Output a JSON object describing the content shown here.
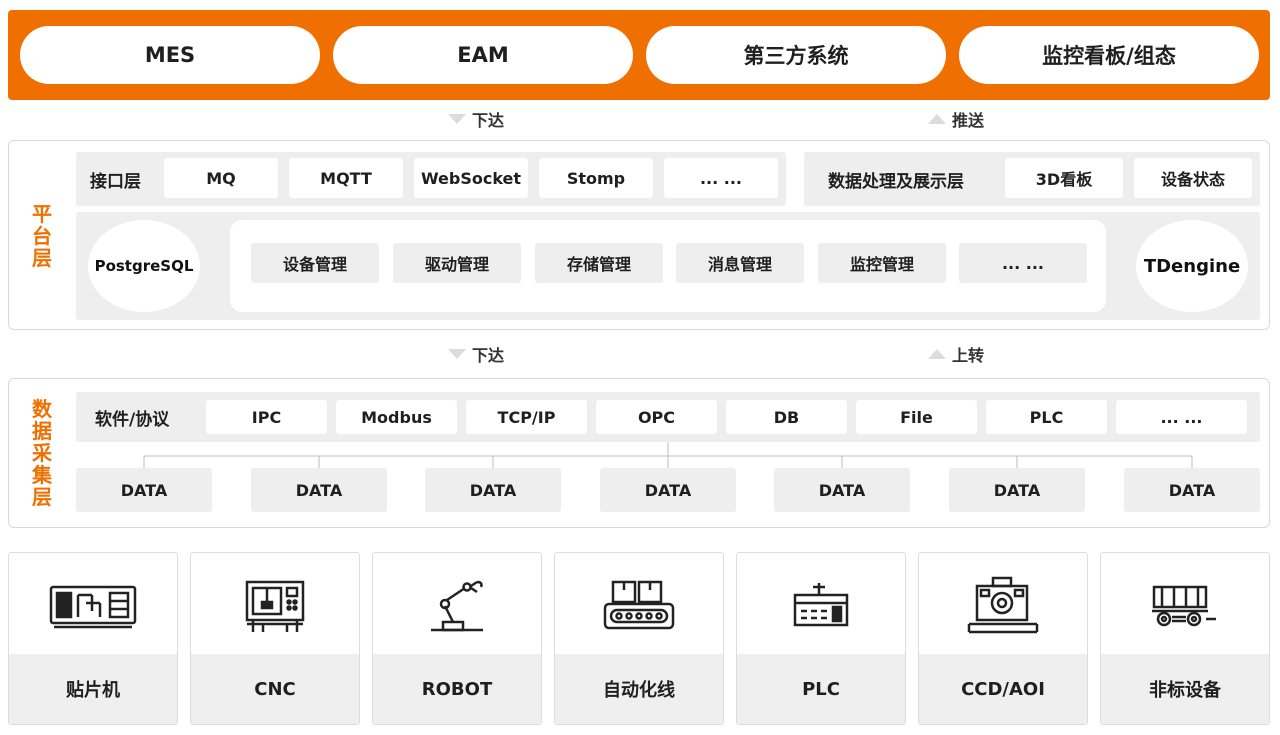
{
  "top_systems": [
    "MES",
    "EAM",
    "第三方系统",
    "监控看板/组态"
  ],
  "flow_top": {
    "down": "下达",
    "up": "推送"
  },
  "platform": {
    "side_label": "平台层",
    "interface_label": "接口层",
    "interface_items": [
      "MQ",
      "MQTT",
      "WebSocket",
      "Stomp",
      "... ..."
    ],
    "display_label": "数据处理及展示层",
    "display_items": [
      "3D看板",
      "设备状态"
    ],
    "left_db": "PostgreSQL",
    "right_db": "TDengine",
    "modules": [
      "设备管理",
      "驱动管理",
      "存储管理",
      "消息管理",
      "监控管理",
      "... ..."
    ]
  },
  "flow_mid": {
    "down": "下达",
    "up": "上转"
  },
  "acquisition": {
    "side_label": "数据采集层",
    "protocol_label": "软件/协议",
    "protocols": [
      "IPC",
      "Modbus",
      "TCP/IP",
      "OPC",
      "DB",
      "File",
      "PLC",
      "... ..."
    ],
    "data_items": [
      "DATA",
      "DATA",
      "DATA",
      "DATA",
      "DATA",
      "DATA",
      "DATA"
    ]
  },
  "devices": [
    {
      "label": "贴片机",
      "icon": "smt-machine-icon"
    },
    {
      "label": "CNC",
      "icon": "cnc-machine-icon"
    },
    {
      "label": "ROBOT",
      "icon": "robot-arm-icon"
    },
    {
      "label": "自动化线",
      "icon": "conveyor-line-icon"
    },
    {
      "label": "PLC",
      "icon": "plc-device-icon"
    },
    {
      "label": "CCD/AOI",
      "icon": "camera-inspection-icon"
    },
    {
      "label": "非标设备",
      "icon": "cart-device-icon"
    }
  ],
  "colors": {
    "accent": "#ef6f00",
    "panel_gray": "#eeeeee",
    "border": "#d9d9d9"
  }
}
